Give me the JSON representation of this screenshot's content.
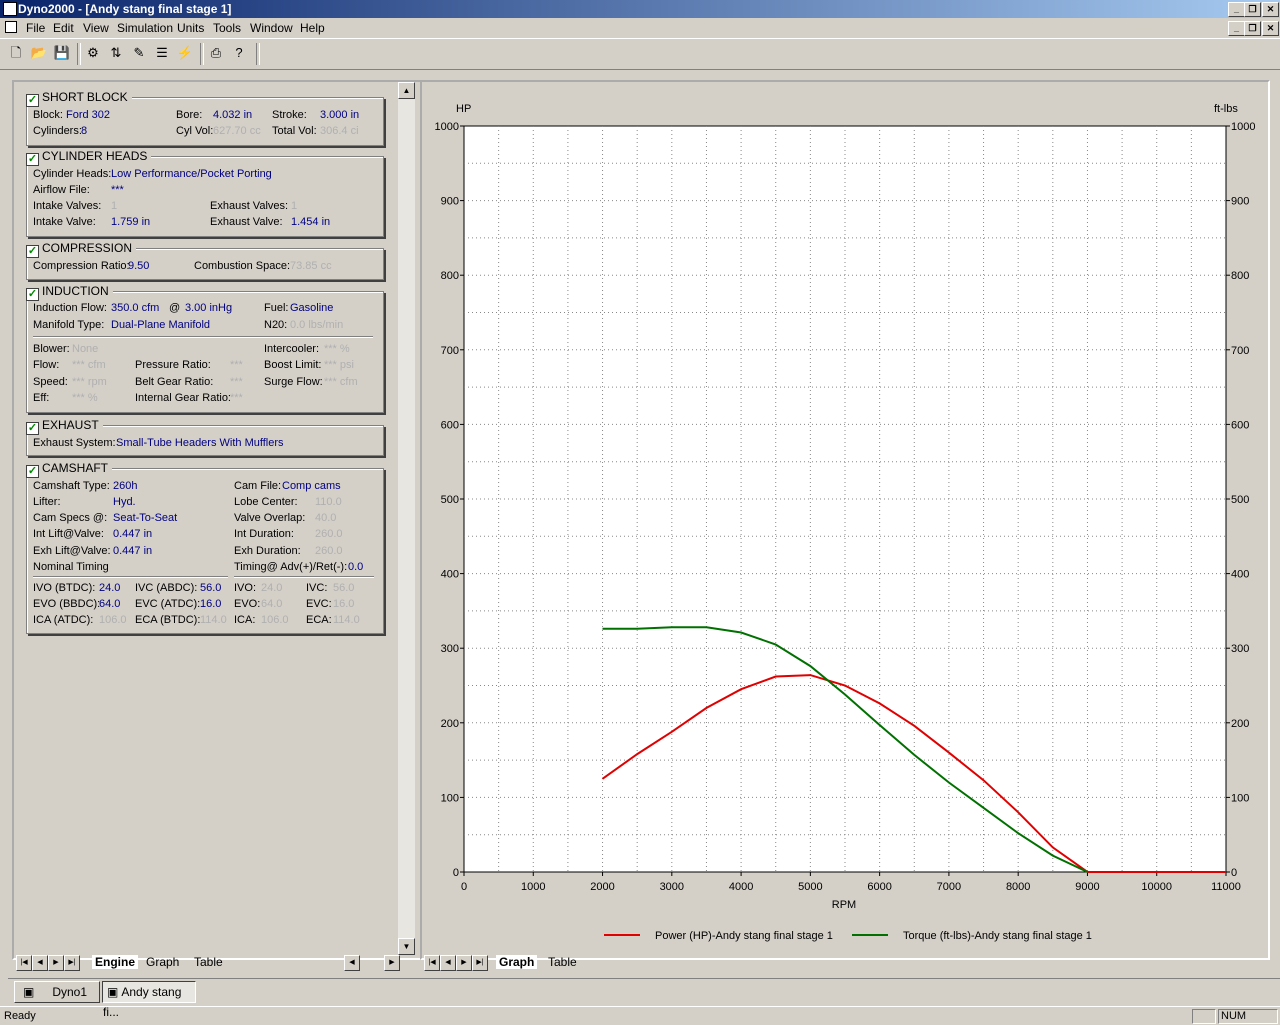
{
  "window": {
    "title": "Dyno2000 - [Andy stang final stage 1]"
  },
  "menu": [
    "File",
    "Edit",
    "View",
    "Simulation",
    "Units",
    "Tools",
    "Window",
    "Help"
  ],
  "toolbar_icons": [
    "new-icon",
    "open-icon",
    "save-icon",
    "engine-icon",
    "cam-icon",
    "tools-icon",
    "heads-icon",
    "dyno-icon",
    "print-icon",
    "help-icon"
  ],
  "short_block": {
    "title": "SHORT BLOCK",
    "block_label": "Block:",
    "block": "Ford 302",
    "bore_label": "Bore:",
    "bore": "4.032 in",
    "stroke_label": "Stroke:",
    "stroke": "3.000 in",
    "cyl_label": "Cylinders:",
    "cyl": "8",
    "cylvol_label": "Cyl Vol:",
    "cylvol": "627.70 cc",
    "totvol_label": "Total Vol:",
    "totvol": "306.4 ci"
  },
  "heads": {
    "title": "CYLINDER HEADS",
    "heads_label": "Cylinder Heads:",
    "heads": "Low Performance/Pocket Porting",
    "airflow_label": "Airflow File:",
    "airflow": "***",
    "iv_label": "Intake Valves:",
    "iv": "1",
    "ev_label": "Exhaust Valves:",
    "ev": "1",
    "ivd_label": "Intake Valve:",
    "ivd": "1.759 in",
    "evd_label": "Exhaust Valve:",
    "evd": "1.454 in"
  },
  "compression": {
    "title": "COMPRESSION",
    "ratio_label": "Compression Ratio:",
    "ratio": "9.50",
    "space_label": "Combustion Space:",
    "space": "73.85 cc"
  },
  "induction": {
    "title": "INDUCTION",
    "flow_label": "Induction Flow:",
    "flow": "350.0 cfm",
    "at": "@",
    "inhg": "3.00 inHg",
    "fuel_label": "Fuel:",
    "fuel": "Gasoline",
    "manifold_label": "Manifold Type:",
    "manifold": "Dual-Plane Manifold",
    "n2o_label": "N20:",
    "n2o": "0.0 lbs/min",
    "blower_label": "Blower:",
    "blower": "None",
    "intercooler_label": "Intercooler:",
    "intercooler": "*** %",
    "bflow_label": "Flow:",
    "bflow": "*** cfm",
    "pr_label": "Pressure Ratio:",
    "pr": "***",
    "boost_label": "Boost Limit:",
    "boost": "*** psi",
    "speed_label": "Speed:",
    "speed": "*** rpm",
    "belt_label": "Belt Gear Ratio:",
    "belt": "***",
    "surge_label": "Surge Flow:",
    "surge": "*** cfm",
    "eff_label": "Eff:",
    "eff": "*** %",
    "igr_label": "Internal Gear Ratio:",
    "igr": "***"
  },
  "exhaust": {
    "title": "EXHAUST",
    "sys_label": "Exhaust System:",
    "sys": "Small-Tube Headers With Mufflers"
  },
  "camshaft": {
    "title": "CAMSHAFT",
    "type_label": "Camshaft Type:",
    "type": "260h",
    "file_label": "Cam File:",
    "file": "Comp cams",
    "lifter_label": "Lifter:",
    "lifter": "Hyd.",
    "lobe_label": "Lobe Center:",
    "lobe": "110.0",
    "specs_label": "Cam Specs @:",
    "specs": "Seat-To-Seat",
    "overlap_label": "Valve Overlap:",
    "overlap": "40.0",
    "intlift_label": "Int Lift@Valve:",
    "intlift": "0.447 in",
    "intdur_label": "Int Duration:",
    "intdur": "260.0",
    "exhlift_label": "Exh Lift@Valve:",
    "exhlift": "0.447 in",
    "exhdur_label": "Exh Duration:",
    "exhdur": "260.0",
    "nominal_label": "Nominal Timing",
    "timing_label": "Timing@ Adv(+)/Ret(-):",
    "timing": "0.0",
    "ivo_label": "IVO  (BTDC):",
    "ivo": "24.0",
    "ivc_label": "IVC  (ABDC):",
    "ivc": "56.0",
    "evo_label": "EVO (BBDC):",
    "evo": "64.0",
    "evc_label": "EVC (ATDC):",
    "evc": "16.0",
    "ica_label": "ICA  (ATDC):",
    "ica": "106.0",
    "eca_label": "ECA (BTDC):",
    "eca": "114.0",
    "ivo2_label": "IVO:",
    "ivo2": "24.0",
    "ivc2_label": "IVC:",
    "ivc2": "56.0",
    "evo2_label": "EVO:",
    "evo2": "64.0",
    "evc2_label": "EVC:",
    "evc2": "16.0",
    "ica2_label": "ICA:",
    "ica2": "106.0",
    "eca2_label": "ECA:",
    "eca2": "114.0"
  },
  "left_tabs": [
    "Engine",
    "Graph",
    "Table"
  ],
  "right_tabs": [
    "Graph",
    "Table"
  ],
  "taskbar": [
    "Dyno1",
    "Andy stang fi..."
  ],
  "status": {
    "text": "Ready",
    "num": "NUM"
  },
  "chart_data": {
    "type": "line",
    "xlabel": "RPM",
    "ylabel": "HP",
    "y2label": "ft-lbs",
    "xlim": [
      0,
      11000
    ],
    "ylim": [
      0,
      1000
    ],
    "xticks": [
      0,
      1000,
      2000,
      3000,
      4000,
      5000,
      6000,
      7000,
      8000,
      9000,
      10000,
      11000
    ],
    "yticks": [
      0,
      100,
      200,
      300,
      400,
      500,
      600,
      700,
      800,
      900,
      1000
    ],
    "grid": true,
    "legend": "bottom",
    "series": [
      {
        "name": "Power (HP)-Andy stang final stage 1",
        "color": "#e00000",
        "x": [
          2000,
          2500,
          3000,
          3500,
          4000,
          4500,
          5000,
          5500,
          6000,
          6500,
          7000,
          7500,
          8000,
          8500,
          9000,
          9500,
          10000,
          10500,
          11000
        ],
        "y": [
          125,
          158,
          188,
          220,
          245,
          262,
          264,
          250,
          226,
          196,
          160,
          123,
          80,
          33,
          0,
          0,
          0,
          0,
          0
        ]
      },
      {
        "name": "Torque (ft-lbs)-Andy stang final stage 1",
        "color": "#007000",
        "x": [
          2000,
          2500,
          3000,
          3500,
          4000,
          4500,
          5000,
          5500,
          6000,
          6500,
          7000,
          7500,
          8000,
          8500,
          9000
        ],
        "y": [
          326,
          326,
          328,
          328,
          321,
          305,
          276,
          238,
          197,
          157,
          120,
          86,
          52,
          22,
          0
        ]
      }
    ]
  }
}
